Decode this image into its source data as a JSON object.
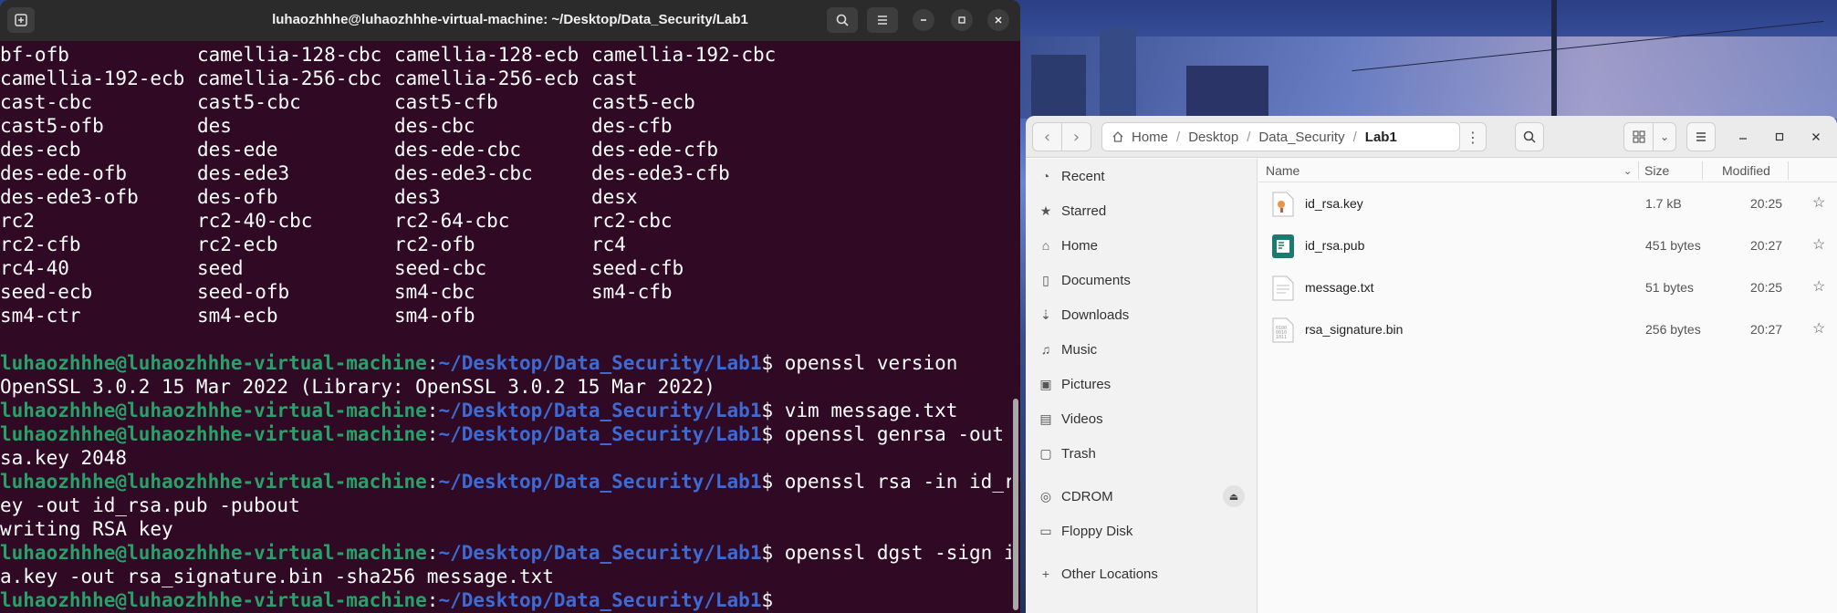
{
  "terminal": {
    "title": "luhaozhhhe@luhaozhhhe-virtual-machine: ~/Desktop/Data_Security/Lab1",
    "ciphers": [
      "bf-ofb",
      "camellia-128-cbc",
      "camellia-128-ecb",
      "camellia-192-cbc",
      "camellia-192-ecb",
      "camellia-256-cbc",
      "camellia-256-ecb",
      "cast",
      "cast-cbc",
      "cast5-cbc",
      "cast5-cfb",
      "cast5-ecb",
      "cast5-ofb",
      "des",
      "des-cbc",
      "des-cfb",
      "des-ecb",
      "des-ede",
      "des-ede-cbc",
      "des-ede-cfb",
      "des-ede-ofb",
      "des-ede3",
      "des-ede3-cbc",
      "des-ede3-cfb",
      "des-ede3-ofb",
      "des-ofb",
      "des3",
      "desx",
      "rc2",
      "rc2-40-cbc",
      "rc2-64-cbc",
      "rc2-cbc",
      "rc2-cfb",
      "rc2-ecb",
      "rc2-ofb",
      "rc4",
      "rc4-40",
      "seed",
      "seed-cbc",
      "seed-cfb",
      "seed-ecb",
      "seed-ofb",
      "sm4-cbc",
      "sm4-cfb",
      "sm4-ctr",
      "sm4-ecb",
      "sm4-ofb",
      ""
    ],
    "prompt_user": "luhaozhhhe@luhaozhhhe-virtual-machine",
    "prompt_path": "~/Desktop/Data_Security/Lab1",
    "cmd1": "$ openssl version",
    "out1": "OpenSSL 3.0.2 15 Mar 2022 (Library: OpenSSL 3.0.2 15 Mar 2022)",
    "cmd2": "$ vim message.txt",
    "cmd3": "$ openssl genrsa -out id_r",
    "cmd3_wrap": "sa.key 2048",
    "cmd4": "$ openssl rsa -in id_rsa.k",
    "cmd4_wrap": "ey -out id_rsa.pub -pubout",
    "out4": "writing RSA key",
    "cmd5": "$ openssl dgst -sign id_rs",
    "cmd5_wrap": "a.key -out rsa_signature.bin -sha256 message.txt",
    "cmd6": "$"
  },
  "files": {
    "breadcrumbs": [
      "Home",
      "Desktop",
      "Data_Security",
      "Lab1"
    ],
    "sidebar": [
      {
        "label": "Recent",
        "icon": "clock-icon"
      },
      {
        "label": "Starred",
        "icon": "star-icon"
      },
      {
        "label": "Home",
        "icon": "home-icon"
      },
      {
        "label": "Documents",
        "icon": "document-icon"
      },
      {
        "label": "Downloads",
        "icon": "download-icon"
      },
      {
        "label": "Music",
        "icon": "music-icon"
      },
      {
        "label": "Pictures",
        "icon": "picture-icon"
      },
      {
        "label": "Videos",
        "icon": "video-icon"
      },
      {
        "label": "Trash",
        "icon": "trash-icon"
      },
      {
        "label": "CDROM",
        "icon": "disc-icon"
      },
      {
        "label": "Floppy Disk",
        "icon": "drive-icon"
      },
      {
        "label": "Other Locations",
        "icon": "plus-icon"
      }
    ],
    "columns": {
      "name": "Name",
      "size": "Size",
      "modified": "Modified"
    },
    "rows": [
      {
        "name": "id_rsa.key",
        "size": "1.7 kB",
        "modified": "20:25"
      },
      {
        "name": "id_rsa.pub",
        "size": "451 bytes",
        "modified": "20:27"
      },
      {
        "name": "message.txt",
        "size": "51 bytes",
        "modified": "20:25"
      },
      {
        "name": "rsa_signature.bin",
        "size": "256 bytes",
        "modified": "20:27"
      }
    ]
  }
}
